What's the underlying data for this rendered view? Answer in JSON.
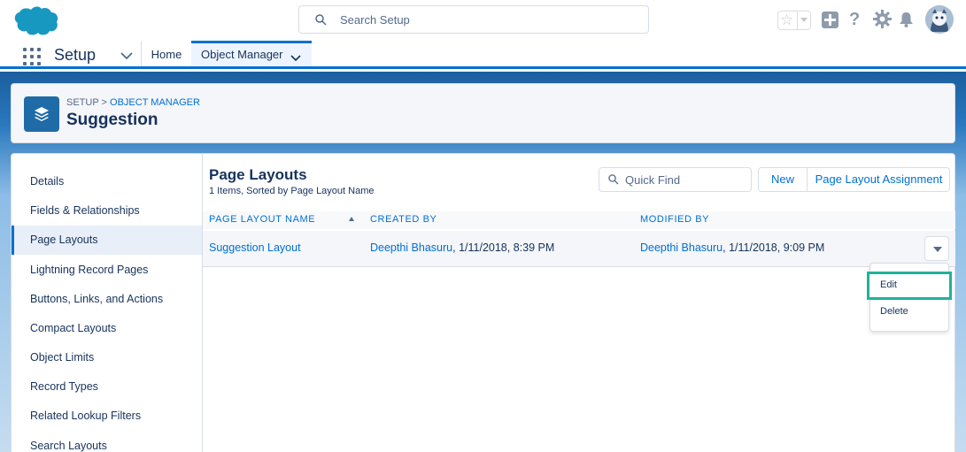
{
  "header": {
    "search_placeholder": "Search Setup"
  },
  "nav": {
    "app_name": "Setup",
    "tabs": [
      {
        "label": "Home"
      },
      {
        "label": "Object Manager"
      }
    ]
  },
  "page_header": {
    "breadcrumb_root": "SETUP",
    "breadcrumb_sep": " > ",
    "breadcrumb_link": "OBJECT MANAGER",
    "title": "Suggestion"
  },
  "sidebar": {
    "items": [
      {
        "label": "Details"
      },
      {
        "label": "Fields & Relationships"
      },
      {
        "label": "Page Layouts"
      },
      {
        "label": "Lightning Record Pages"
      },
      {
        "label": "Buttons, Links, and Actions"
      },
      {
        "label": "Compact Layouts"
      },
      {
        "label": "Object Limits"
      },
      {
        "label": "Record Types"
      },
      {
        "label": "Related Lookup Filters"
      },
      {
        "label": "Search Layouts"
      }
    ],
    "active_index": 2
  },
  "content": {
    "title": "Page Layouts",
    "subtitle": "1 Items, Sorted by Page Layout Name",
    "quick_find_placeholder": "Quick Find",
    "buttons": {
      "new": "New",
      "assignment": "Page Layout Assignment"
    },
    "columns": [
      "PAGE LAYOUT NAME",
      "CREATED BY",
      "MODIFIED BY"
    ],
    "rows": [
      {
        "name": "Suggestion Layout",
        "created_user": "Deepthi Bhasuru",
        "created_date": ", 1/11/2018, 8:39 PM",
        "modified_user": "Deepthi Bhasuru",
        "modified_date": ", 1/11/2018, 9:09 PM"
      }
    ]
  },
  "row_menu": {
    "items": [
      {
        "label": "Edit"
      },
      {
        "label": "Delete"
      }
    ]
  },
  "colors": {
    "brand": "#0070d2",
    "highlight": "#1fb39a",
    "text": "#16325c"
  }
}
